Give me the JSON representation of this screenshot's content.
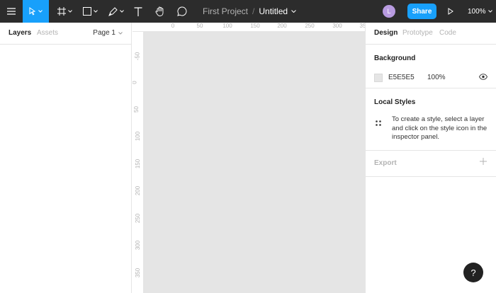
{
  "toolbar": {
    "project_name": "First Project",
    "separator": "/",
    "file_name": "Untitled",
    "avatar_initial": "L",
    "share_label": "Share",
    "zoom_level": "100%"
  },
  "left_panel": {
    "tabs": [
      {
        "label": "Layers",
        "active": true
      },
      {
        "label": "Assets",
        "active": false
      }
    ],
    "page_label": "Page 1"
  },
  "rulers": {
    "top": [
      "0",
      "50",
      "100",
      "150",
      "200",
      "250",
      "300",
      "35"
    ],
    "left": [
      "-50",
      "0",
      "50",
      "100",
      "150",
      "200",
      "250",
      "300",
      "350"
    ]
  },
  "right_panel": {
    "tabs": [
      {
        "label": "Design",
        "active": true
      },
      {
        "label": "Prototype",
        "active": false
      },
      {
        "label": "Code",
        "active": false
      }
    ],
    "background": {
      "title": "Background",
      "color_hex": "E5E5E5",
      "opacity": "100%"
    },
    "local_styles": {
      "title": "Local Styles",
      "description": "To create a style, select a layer and click on the style icon in the inspector panel."
    },
    "export": {
      "title": "Export"
    }
  },
  "help_label": "?",
  "colors": {
    "toolbar_bg": "#2c2c2c",
    "accent": "#18a0fb",
    "canvas_bg": "#e5e5e5"
  }
}
